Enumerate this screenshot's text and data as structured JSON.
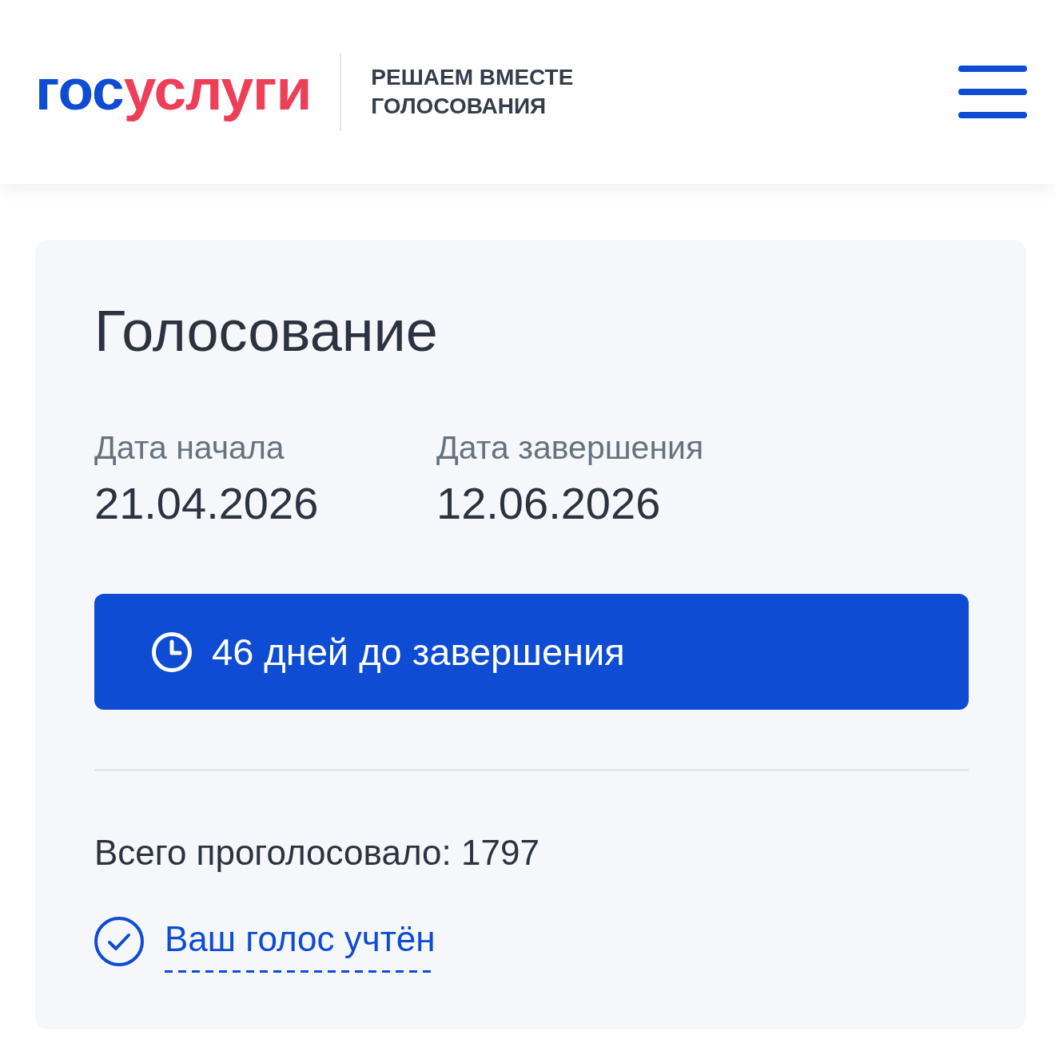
{
  "header": {
    "logo": {
      "parts": [
        "гос",
        "услуги"
      ]
    },
    "tagline": [
      "РЕШАЕМ ВМЕСТЕ",
      "ГОЛОСОВАНИЯ"
    ]
  },
  "card": {
    "title": "Голосование",
    "dates": [
      {
        "label": "Дата начала",
        "value": "21.04.2026"
      },
      {
        "label": "Дата завершения",
        "value": "12.06.2026"
      }
    ],
    "countdown": {
      "text": "46 дней до завершения"
    },
    "total": "Всего проголосовало: 1797",
    "vote_status": {
      "text": "Ваш голос учтён"
    }
  }
}
